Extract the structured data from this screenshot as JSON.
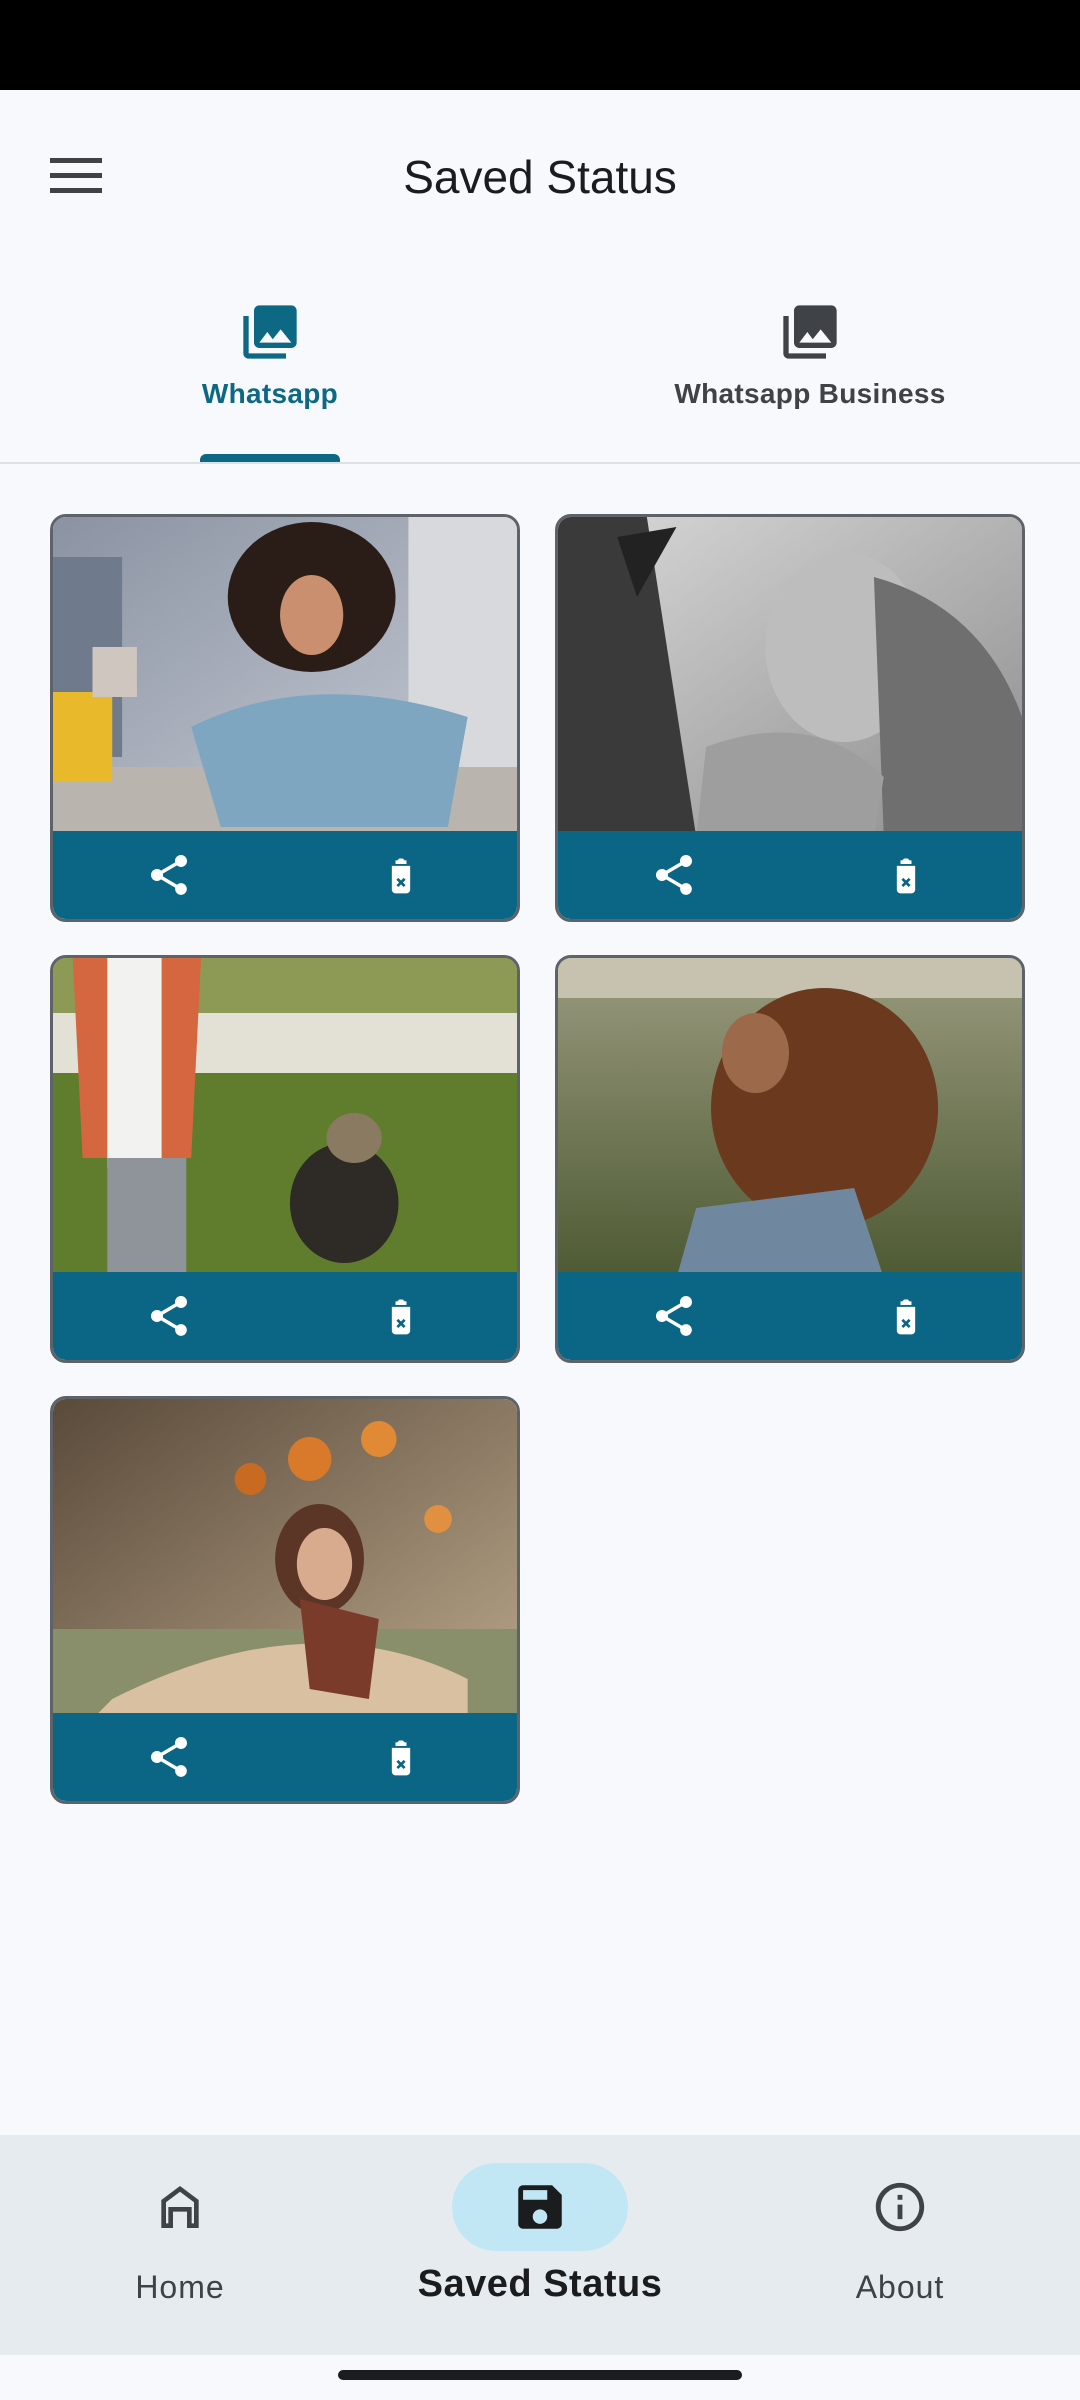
{
  "app_bar": {
    "title": "Saved Status",
    "menu_icon": "menu-icon"
  },
  "tabs": [
    {
      "label": "Whatsapp",
      "icon": "photo-library-icon",
      "selected": true
    },
    {
      "label": "Whatsapp Business",
      "icon": "photo-library-icon",
      "selected": false
    }
  ],
  "grid": {
    "items": [
      {
        "photo": "woman with curly hair holding shopping bags",
        "actions": [
          "share-icon",
          "delete-icon"
        ]
      },
      {
        "photo": "black and white woman leaning out of car window",
        "actions": [
          "share-icon",
          "delete-icon"
        ]
      },
      {
        "photo": "person walking a small dog on grass",
        "actions": [
          "share-icon",
          "delete-icon"
        ]
      },
      {
        "photo": "woman with curly hair in a field",
        "actions": [
          "share-icon",
          "delete-icon"
        ]
      },
      {
        "photo": "woman in coat with falling autumn leaves",
        "actions": [
          "share-icon",
          "delete-icon"
        ]
      }
    ]
  },
  "bottom_nav": {
    "items": [
      {
        "label": "Home",
        "icon": "home-icon",
        "selected": false
      },
      {
        "label": "Saved Status",
        "icon": "save-icon",
        "selected": true
      },
      {
        "label": "About",
        "icon": "info-icon",
        "selected": false
      }
    ]
  },
  "colors": {
    "accent": "#0d6883",
    "card_bar": "#0b6584",
    "nav_bg": "#e6ebf0",
    "selected_pill": "#c2e7f4"
  }
}
